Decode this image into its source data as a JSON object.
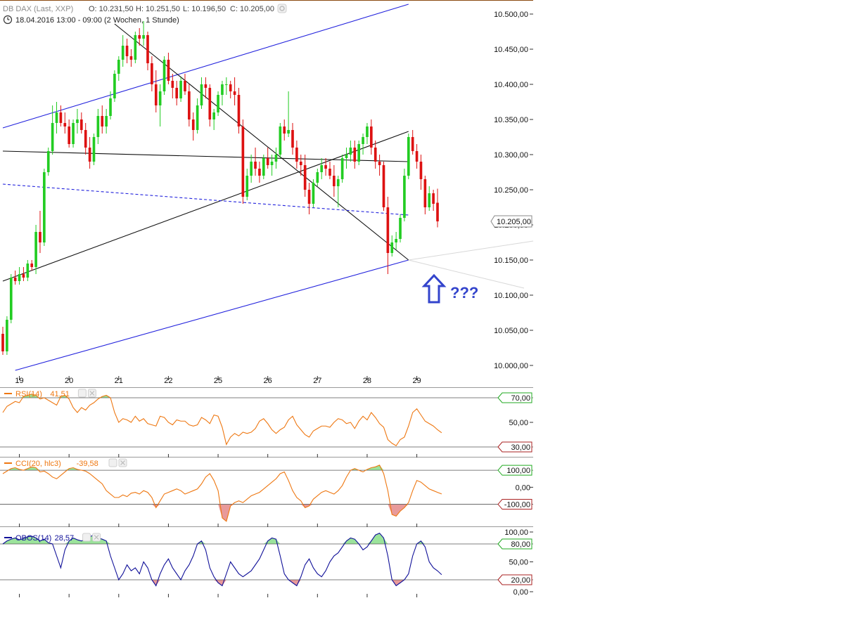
{
  "header": {
    "instrument": "DB DAX (Last, XXP)",
    "open": "O: 10.231,50",
    "high": "H: 10.251,50",
    "low": "L: 10.196,50",
    "close": "C: 10.205,00",
    "period": "18.04.2016 13:00 - 09:00 (2 Wochen, 1 Stunde)"
  },
  "colors": {
    "up": "#22cc22",
    "down": "#dd1111",
    "trend_blue": "#2222dd",
    "trend_black": "#111111",
    "indicator": "#ee7711",
    "obos": "#111199",
    "overbought_fill": "#9be39b",
    "oversold_fill": "#e89a9a",
    "annotation": "#3344cc"
  },
  "annotation": {
    "text": "???",
    "icon": "arrow-up-outline-icon"
  },
  "chart_data": [
    {
      "type": "candlestick",
      "title": "DB DAX (Last, XXP)",
      "interval": "1 Stunde",
      "x_tick_labels": [
        "19",
        "20",
        "21",
        "22",
        "25",
        "26",
        "27",
        "28",
        "29"
      ],
      "y_tick_labels": [
        "10.000,00",
        "10.050,00",
        "10.100,00",
        "10.150,00",
        "10.200,00",
        "10.250,00",
        "10.300,00",
        "10.350,00",
        "10.400,00",
        "10.450,00",
        "10.500,00"
      ],
      "ylim": [
        9985,
        10515
      ],
      "last_price_label": "10.205,00",
      "last_price": 10205,
      "candles": [
        [
          10045,
          10055,
          10015,
          10020
        ],
        [
          10020,
          10070,
          10015,
          10065
        ],
        [
          10065,
          10130,
          10060,
          10125
        ],
        [
          10125,
          10135,
          10115,
          10120
        ],
        [
          10120,
          10140,
          10115,
          10130
        ],
        [
          10130,
          10140,
          10120,
          10125
        ],
        [
          10125,
          10150,
          10120,
          10145
        ],
        [
          10145,
          10150,
          10135,
          10140
        ],
        [
          10140,
          10200,
          10130,
          10190
        ],
        [
          10190,
          10220,
          10160,
          10175
        ],
        [
          10175,
          10280,
          10170,
          10275
        ],
        [
          10275,
          10310,
          10270,
          10305
        ],
        [
          10305,
          10370,
          10300,
          10345
        ],
        [
          10345,
          10375,
          10330,
          10360
        ],
        [
          10360,
          10370,
          10340,
          10345
        ],
        [
          10345,
          10360,
          10330,
          10340
        ],
        [
          10340,
          10350,
          10310,
          10315
        ],
        [
          10315,
          10350,
          10310,
          10345
        ],
        [
          10345,
          10365,
          10330,
          10350
        ],
        [
          10350,
          10360,
          10330,
          10335
        ],
        [
          10335,
          10345,
          10300,
          10310
        ],
        [
          10310,
          10325,
          10280,
          10290
        ],
        [
          10290,
          10330,
          10285,
          10325
        ],
        [
          10325,
          10365,
          10315,
          10355
        ],
        [
          10355,
          10370,
          10330,
          10340
        ],
        [
          10340,
          10365,
          10330,
          10355
        ],
        [
          10355,
          10390,
          10350,
          10380
        ],
        [
          10380,
          10420,
          10375,
          10415
        ],
        [
          10415,
          10440,
          10405,
          10435
        ],
        [
          10435,
          10470,
          10425,
          10455
        ],
        [
          10455,
          10465,
          10430,
          10440
        ],
        [
          10440,
          10450,
          10425,
          10435
        ],
        [
          10435,
          10475,
          10430,
          10470
        ],
        [
          10470,
          10480,
          10455,
          10465
        ],
        [
          10465,
          10490,
          10455,
          10470
        ],
        [
          10470,
          10475,
          10420,
          10430
        ],
        [
          10430,
          10440,
          10390,
          10400
        ],
        [
          10400,
          10420,
          10360,
          10370
        ],
        [
          10370,
          10400,
          10340,
          10390
        ],
        [
          10390,
          10440,
          10385,
          10435
        ],
        [
          10435,
          10445,
          10400,
          10405
        ],
        [
          10405,
          10415,
          10380,
          10395
        ],
        [
          10395,
          10405,
          10370,
          10380
        ],
        [
          10380,
          10410,
          10375,
          10405
        ],
        [
          10405,
          10415,
          10385,
          10390
        ],
        [
          10390,
          10400,
          10340,
          10350
        ],
        [
          10350,
          10360,
          10320,
          10335
        ],
        [
          10335,
          10380,
          10330,
          10370
        ],
        [
          10370,
          10410,
          10365,
          10400
        ],
        [
          10400,
          10410,
          10380,
          10395
        ],
        [
          10395,
          10400,
          10340,
          10350
        ],
        [
          10350,
          10365,
          10335,
          10360
        ],
        [
          10360,
          10390,
          10355,
          10385
        ],
        [
          10385,
          10405,
          10370,
          10400
        ],
        [
          10400,
          10410,
          10385,
          10400
        ],
        [
          10400,
          10405,
          10380,
          10390
        ],
        [
          10390,
          10410,
          10370,
          10385
        ],
        [
          10385,
          10395,
          10330,
          10340
        ],
        [
          10340,
          10350,
          10230,
          10240
        ],
        [
          10240,
          10280,
          10235,
          10270
        ],
        [
          10270,
          10300,
          10260,
          10290
        ],
        [
          10290,
          10310,
          10270,
          10280
        ],
        [
          10280,
          10290,
          10260,
          10270
        ],
        [
          10270,
          10300,
          10265,
          10295
        ],
        [
          10295,
          10310,
          10280,
          10285
        ],
        [
          10285,
          10300,
          10270,
          10290
        ],
        [
          10290,
          10310,
          10280,
          10300
        ],
        [
          10300,
          10345,
          10295,
          10340
        ],
        [
          10340,
          10350,
          10320,
          10330
        ],
        [
          10330,
          10390,
          10325,
          10335
        ],
        [
          10335,
          10345,
          10300,
          10310
        ],
        [
          10310,
          10320,
          10280,
          10290
        ],
        [
          10290,
          10300,
          10270,
          10285
        ],
        [
          10285,
          10300,
          10240,
          10250
        ],
        [
          10250,
          10260,
          10215,
          10230
        ],
        [
          10230,
          10265,
          10225,
          10260
        ],
        [
          10260,
          10280,
          10255,
          10275
        ],
        [
          10275,
          10295,
          10265,
          10285
        ],
        [
          10285,
          10295,
          10270,
          10280
        ],
        [
          10280,
          10290,
          10265,
          10270
        ],
        [
          10270,
          10285,
          10240,
          10255
        ],
        [
          10255,
          10270,
          10225,
          10265
        ],
        [
          10265,
          10300,
          10260,
          10295
        ],
        [
          10295,
          10310,
          10280,
          10300
        ],
        [
          10300,
          10320,
          10290,
          10310
        ],
        [
          10310,
          10320,
          10280,
          10290
        ],
        [
          10290,
          10320,
          10285,
          10315
        ],
        [
          10315,
          10330,
          10300,
          10325
        ],
        [
          10325,
          10345,
          10315,
          10340
        ],
        [
          10340,
          10350,
          10300,
          10310
        ],
        [
          10310,
          10320,
          10280,
          10290
        ],
        [
          10290,
          10300,
          10270,
          10285
        ],
        [
          10285,
          10290,
          10220,
          10225
        ],
        [
          10225,
          10240,
          10130,
          10160
        ],
        [
          10160,
          10185,
          10155,
          10175
        ],
        [
          10175,
          10190,
          10165,
          10180
        ],
        [
          10180,
          10215,
          10175,
          10210
        ],
        [
          10210,
          10280,
          10205,
          10270
        ],
        [
          10270,
          10330,
          10265,
          10325
        ],
        [
          10325,
          10335,
          10300,
          10305
        ],
        [
          10305,
          10315,
          10280,
          10290
        ],
        [
          10290,
          10300,
          10250,
          10265
        ],
        [
          10265,
          10270,
          10215,
          10225
        ],
        [
          10225,
          10255,
          10220,
          10245
        ],
        [
          10245,
          10250,
          10220,
          10230
        ],
        [
          10231.5,
          10251.5,
          10196.5,
          10205
        ]
      ],
      "trend_lines": [
        {
          "name": "upper-channel-blue",
          "color": "#2222dd",
          "style": "solid",
          "from": [
            0,
            10338
          ],
          "to": [
            98,
            10514
          ]
        },
        {
          "name": "lower-channel-blue",
          "color": "#2222dd",
          "style": "solid",
          "from": [
            3,
            9993
          ],
          "to": [
            98,
            10150
          ]
        },
        {
          "name": "descending-black",
          "color": "#111111",
          "style": "solid",
          "from": [
            27,
            10486
          ],
          "to": [
            98,
            10150
          ]
        },
        {
          "name": "ascending-black",
          "color": "#111111",
          "style": "solid",
          "from": [
            0,
            10120
          ],
          "to": [
            98,
            10333
          ]
        },
        {
          "name": "horizontal-black",
          "color": "#111111",
          "style": "solid",
          "from": [
            0,
            10305
          ],
          "to": [
            98,
            10290
          ]
        },
        {
          "name": "support-dashed-blue",
          "color": "#2222dd",
          "style": "dashed",
          "from": [
            0,
            10258
          ],
          "to": [
            98,
            10214
          ]
        }
      ]
    },
    {
      "type": "line",
      "name": "RSI(14)",
      "label": "RSI(14)",
      "value_label": "41,51",
      "ylim": [
        22,
        78
      ],
      "levels": [
        {
          "value": 70,
          "label": "70,00"
        },
        {
          "value": 30,
          "label": "30,00"
        }
      ],
      "tick_labels": [
        "50,00"
      ],
      "values": [
        58,
        63,
        65,
        67,
        66,
        71,
        72,
        73,
        72,
        69,
        70,
        68,
        66,
        64,
        71,
        72,
        69,
        62,
        58,
        62,
        60,
        64,
        66,
        69,
        71,
        72,
        70,
        58,
        50,
        53,
        52,
        50,
        55,
        51,
        53,
        49,
        48,
        47,
        55,
        54,
        50,
        48,
        52,
        51,
        51,
        48,
        47,
        48,
        54,
        52,
        49,
        56,
        55,
        46,
        32,
        38,
        41,
        39,
        42,
        41,
        42,
        45,
        51,
        53,
        49,
        44,
        41,
        44,
        46,
        52,
        55,
        48,
        44,
        40,
        38,
        43,
        45,
        47,
        47,
        46,
        50,
        53,
        52,
        49,
        50,
        45,
        51,
        55,
        52,
        58,
        54,
        49,
        46,
        36,
        33,
        31,
        36,
        38,
        47,
        58,
        61,
        56,
        51,
        49,
        47,
        44,
        41.51
      ]
    },
    {
      "type": "line",
      "name": "CCI(20, hlc3)",
      "label": "CCI(20, hlc3)",
      "value_label": "-39,58",
      "ylim": [
        -230,
        175
      ],
      "levels": [
        {
          "value": 100,
          "label": "100,00"
        },
        {
          "value": 0,
          "label": "0,00"
        },
        {
          "value": -100,
          "label": "-100,00"
        }
      ],
      "values": [
        80,
        95,
        110,
        115,
        105,
        100,
        110,
        120,
        115,
        90,
        95,
        80,
        60,
        50,
        70,
        90,
        110,
        115,
        105,
        100,
        95,
        80,
        60,
        40,
        20,
        -20,
        -40,
        -60,
        -60,
        -45,
        -55,
        -35,
        -30,
        -40,
        -20,
        -30,
        -60,
        -120,
        -80,
        -40,
        -30,
        -20,
        -10,
        -20,
        -40,
        -30,
        -20,
        -10,
        20,
        60,
        80,
        40,
        -20,
        -180,
        -200,
        -110,
        -90,
        -80,
        -90,
        -70,
        -50,
        -40,
        -30,
        -10,
        10,
        30,
        50,
        80,
        90,
        40,
        -20,
        -60,
        -80,
        -120,
        -110,
        -70,
        -50,
        -30,
        -20,
        -30,
        -40,
        -20,
        10,
        60,
        100,
        110,
        100,
        90,
        105,
        115,
        120,
        130,
        80,
        -20,
        -160,
        -170,
        -140,
        -120,
        -90,
        -20,
        40,
        30,
        10,
        -10,
        -20,
        -30,
        -39.58
      ]
    },
    {
      "type": "line",
      "name": "OBOS(14)",
      "label": "OBOS(14)",
      "value_label": "28,57",
      "ylim": [
        0,
        100
      ],
      "levels": [
        {
          "value": 80,
          "label": "80,00"
        },
        {
          "value": 20,
          "label": "20,00"
        }
      ],
      "tick_labels": [
        "100,00",
        "50,00",
        "0,00"
      ],
      "values": [
        80,
        85,
        88,
        90,
        87,
        89,
        92,
        93,
        90,
        85,
        88,
        82,
        80,
        60,
        40,
        70,
        85,
        90,
        87,
        85,
        88,
        92,
        95,
        90,
        88,
        85,
        60,
        40,
        20,
        30,
        45,
        35,
        40,
        30,
        50,
        40,
        20,
        10,
        30,
        45,
        55,
        40,
        30,
        20,
        35,
        45,
        60,
        80,
        85,
        70,
        40,
        25,
        15,
        10,
        30,
        50,
        40,
        30,
        25,
        30,
        35,
        45,
        55,
        70,
        85,
        90,
        88,
        60,
        30,
        20,
        15,
        10,
        25,
        45,
        55,
        40,
        30,
        25,
        35,
        50,
        60,
        65,
        75,
        85,
        90,
        88,
        80,
        70,
        75,
        85,
        95,
        98,
        90,
        60,
        20,
        10,
        15,
        20,
        30,
        60,
        80,
        85,
        75,
        50,
        40,
        35,
        28.57
      ]
    }
  ]
}
